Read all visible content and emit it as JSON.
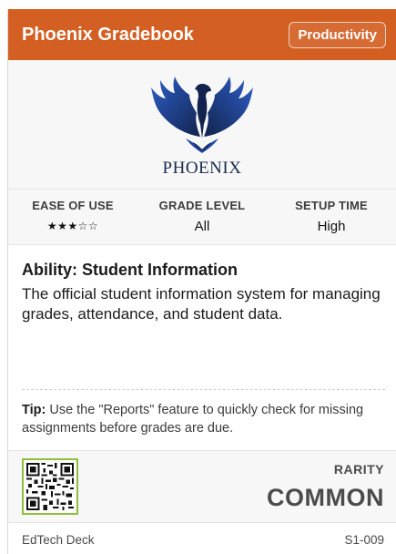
{
  "header": {
    "title": "Phoenix Gradebook",
    "category": "Productivity"
  },
  "logo": {
    "wordmark": "PHOENIX",
    "icon": "phoenix-emblem-icon"
  },
  "stats": [
    {
      "label": "EASE OF USE",
      "value": "★★★☆☆"
    },
    {
      "label": "GRADE LEVEL",
      "value": "All"
    },
    {
      "label": "SETUP TIME",
      "value": "High"
    }
  ],
  "ability": {
    "title": "Ability: Student Information",
    "text": "The official student information system for managing grades, attendance, and student data."
  },
  "tip": {
    "label": "Tip:",
    "text": " Use the \"Reports\" feature to quickly check for missing assignments before grades are due."
  },
  "footer": {
    "rarity_label": "RARITY",
    "rarity_value": "COMMON",
    "qr_icon": "qr-code-icon"
  },
  "bottom": {
    "deck": "EdTech Deck",
    "code": "S1-009"
  },
  "colors": {
    "header": "#d35f22",
    "logo_blue": "#1f4aa8",
    "logo_dark": "#12234d",
    "qr_border": "#8fbf3a"
  }
}
